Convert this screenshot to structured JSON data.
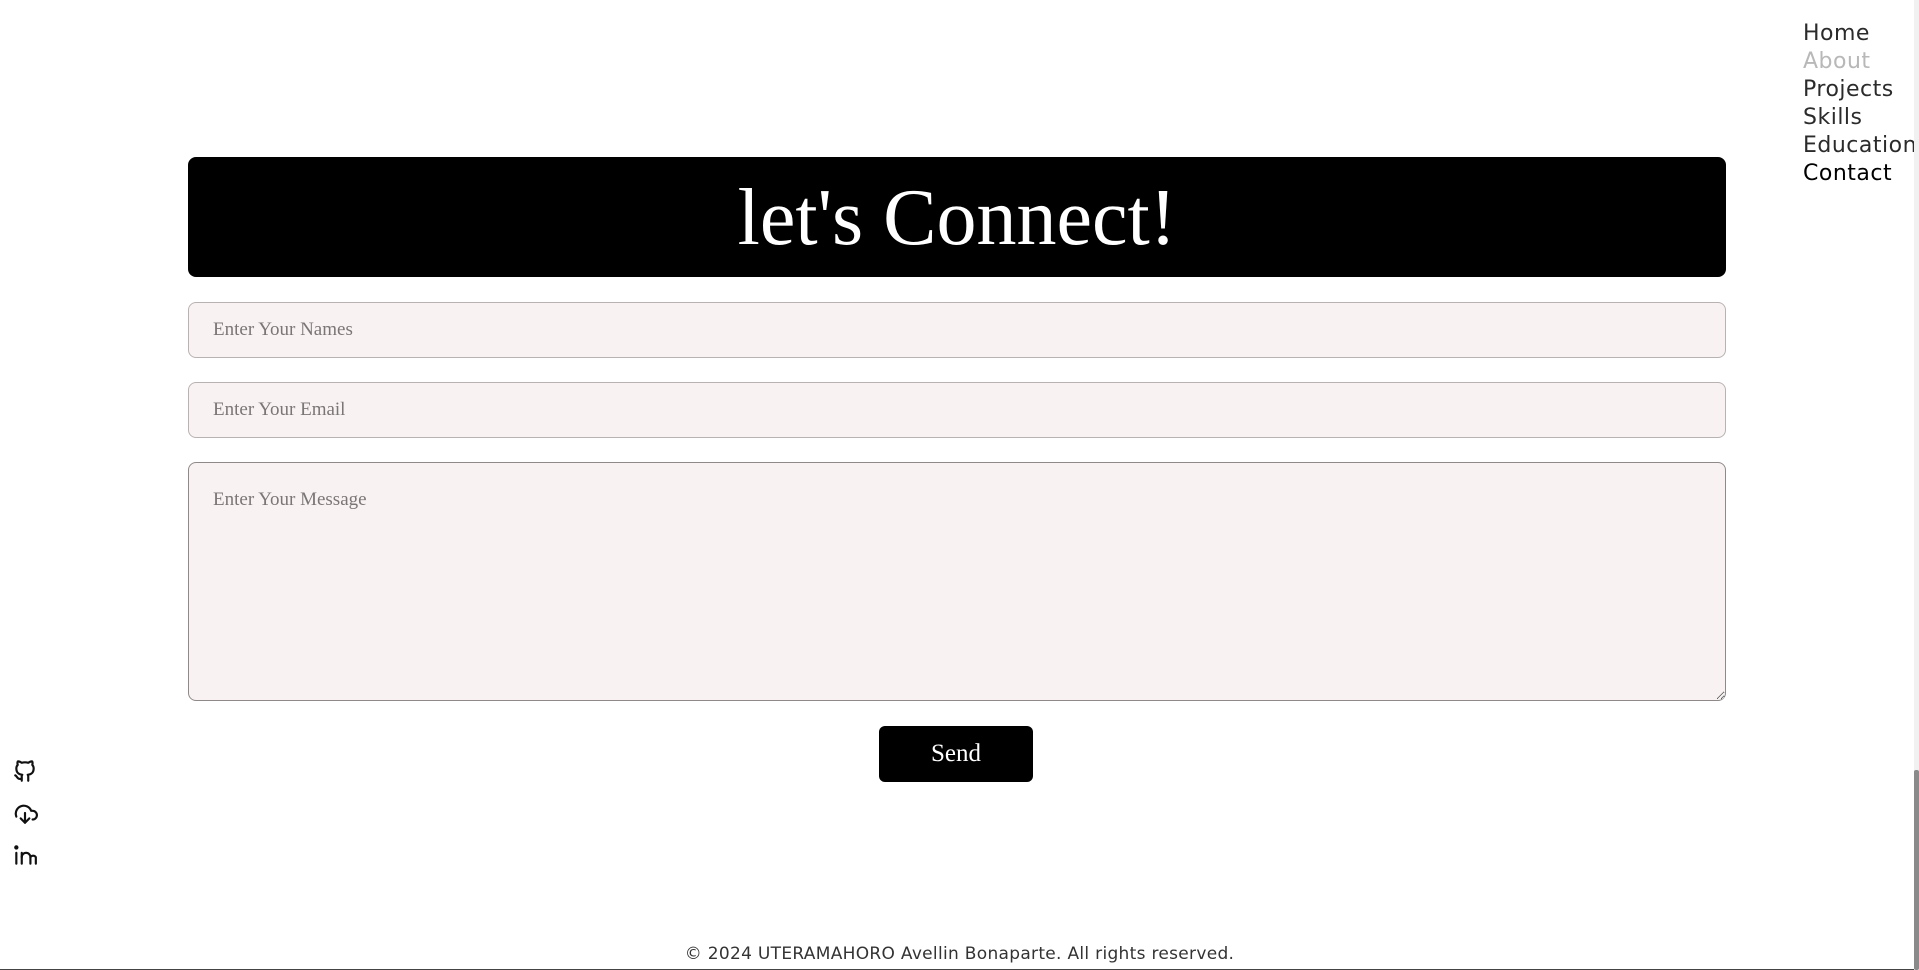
{
  "nav": {
    "items": [
      {
        "label": "Home",
        "state": "normal"
      },
      {
        "label": "About",
        "state": "muted"
      },
      {
        "label": "Projects",
        "state": "normal"
      },
      {
        "label": "Skills",
        "state": "normal"
      },
      {
        "label": "Education",
        "state": "normal"
      },
      {
        "label": "Contact",
        "state": "active"
      }
    ]
  },
  "banner": {
    "title": "let's Connect!"
  },
  "form": {
    "name_placeholder": "Enter Your Names",
    "email_placeholder": "Enter Your Email",
    "message_placeholder": "Enter Your Message",
    "name_value": "",
    "email_value": "",
    "message_value": "",
    "send_label": "Send"
  },
  "social": {
    "icons": [
      "github-icon",
      "cloud-download-icon",
      "linkedin-icon"
    ]
  },
  "footer": {
    "text": "© 2024 UTERAMAHORO Avellin Bonaparte. All rights reserved."
  },
  "colors": {
    "banner_bg": "#000000",
    "field_bg": "#f8f2f2",
    "button_bg": "#000000",
    "nav_muted": "#b8b8b8"
  }
}
